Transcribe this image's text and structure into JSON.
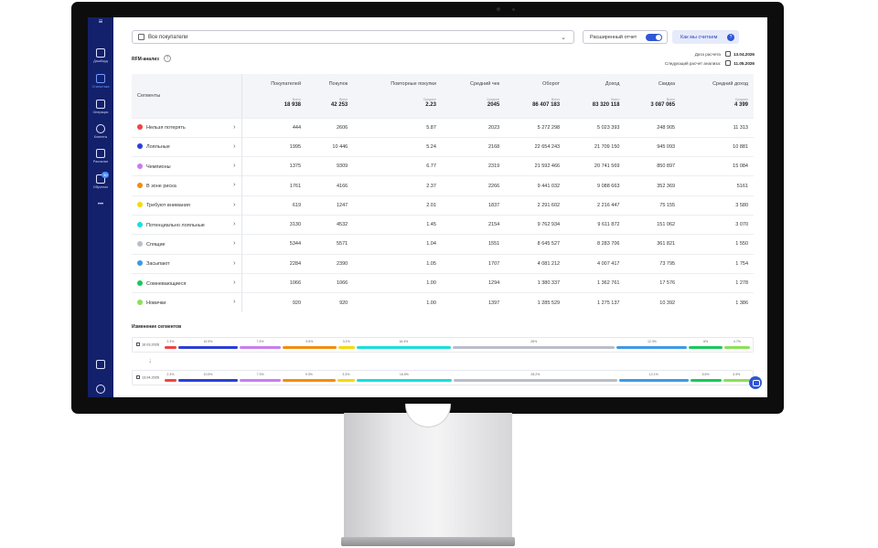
{
  "sidebar": {
    "items": [
      {
        "label": "Дашборд",
        "icon": "dashboard-icon"
      },
      {
        "label": "Статистика",
        "icon": "statistics-icon",
        "active": true
      },
      {
        "label": "Операции",
        "icon": "operations-icon"
      },
      {
        "label": "Клиенты",
        "icon": "clients-icon"
      },
      {
        "label": "Рассылки",
        "icon": "mailing-icon"
      },
      {
        "label": "Обучение",
        "icon": "learning-icon",
        "badge": "30"
      }
    ],
    "more": "•••"
  },
  "filter": {
    "value": "Все покупатели"
  },
  "extended_report": {
    "label": "Расширенный отчет",
    "on": true
  },
  "how_we_count": {
    "label": "Как мы считаем"
  },
  "rfm_title": "RFM-анализ",
  "dates": {
    "calc_label": "Дата расчета",
    "calc_value": "13.04.2026",
    "next_label": "Следующий расчет анализа:",
    "next_value": "11.05.2026"
  },
  "table": {
    "segment_header": "Сегменты",
    "columns": [
      {
        "label": "Покупателей",
        "tot_label": "Всего",
        "tot": "18 938"
      },
      {
        "label": "Покупок",
        "tot_label": "Всего",
        "tot": "42 253"
      },
      {
        "label": "Повторные покупки",
        "tot_label": "Среднее",
        "tot": "2.23"
      },
      {
        "label": "Средний чек",
        "tot_label": "Среднее",
        "tot": "2045"
      },
      {
        "label": "Оборот",
        "tot_label": "Всего",
        "tot": "86 407 183"
      },
      {
        "label": "Доход",
        "tot_label": "Всего",
        "tot": "83 320 118"
      },
      {
        "label": "Скидка",
        "tot_label": "Всего",
        "tot": "3 087 065"
      },
      {
        "label": "Средний доход",
        "tot_label": "Среднее",
        "tot": "4 399"
      }
    ],
    "rows": [
      {
        "name": "Нельзя потерять",
        "color": "#ef4444",
        "vals": [
          "444",
          "2606",
          "5.87",
          "2023",
          "5 272 298",
          "5 023 393",
          "248 905",
          "11 313"
        ]
      },
      {
        "name": "Лояльные",
        "color": "#2b3fd6",
        "vals": [
          "1995",
          "10 446",
          "5.24",
          "2168",
          "22 654 243",
          "21 709 150",
          "945 093",
          "10 881"
        ]
      },
      {
        "name": "Чемпионы",
        "color": "#c77df0",
        "vals": [
          "1375",
          "9309",
          "6.77",
          "2319",
          "21 592 466",
          "20 741 569",
          "850 897",
          "15 084"
        ]
      },
      {
        "name": "В зоне риска",
        "color": "#f28c0f",
        "vals": [
          "1761",
          "4166",
          "2.37",
          "2266",
          "9 441 032",
          "9 088 663",
          "352 369",
          "5161"
        ]
      },
      {
        "name": "Требуют внимания",
        "color": "#f5d90a",
        "vals": [
          "619",
          "1247",
          "2.01",
          "1837",
          "2 291 602",
          "2 216 447",
          "75 155",
          "3 580"
        ]
      },
      {
        "name": "Потенциально лояльные",
        "color": "#19dede",
        "vals": [
          "3130",
          "4532",
          "1.45",
          "2154",
          "9 762 934",
          "9 611 872",
          "151 062",
          "3 070"
        ]
      },
      {
        "name": "Спящие",
        "color": "#b9bec9",
        "vals": [
          "5344",
          "5571",
          "1.04",
          "1551",
          "8 645 527",
          "8 283 706",
          "361 821",
          "1 550"
        ]
      },
      {
        "name": "Засыпают",
        "color": "#3d9ae8",
        "vals": [
          "2284",
          "2390",
          "1.05",
          "1707",
          "4 081 212",
          "4 007 417",
          "73 795",
          "1 754"
        ]
      },
      {
        "name": "Сомневающиеся",
        "color": "#18c95a",
        "vals": [
          "1066",
          "1066",
          "1.00",
          "1294",
          "1 380 337",
          "1 362 761",
          "17 576",
          "1 278"
        ]
      },
      {
        "name": "Новички",
        "color": "#8be05a",
        "vals": [
          "920",
          "920",
          "1.00",
          "1397",
          "1 285 529",
          "1 275 137",
          "10 392",
          "1 386"
        ]
      }
    ]
  },
  "changes": {
    "title": "Изменение сегментов",
    "rows": [
      {
        "date": "16.03.2026",
        "pcts": [
          "2.3%",
          "10.5%",
          "7.3%",
          "9.5%",
          "3.1%",
          "16.4%",
          "28%",
          "12.3%",
          "6%",
          "4.7%"
        ],
        "shares": [
          2.3,
          10.5,
          7.3,
          9.5,
          3.1,
          16.4,
          28,
          12.3,
          6,
          4.7
        ]
      },
      {
        "date": "13.04.2026",
        "pcts": [
          "2.3%",
          "10.5%",
          "7.3%",
          "9.3%",
          "3.3%",
          "16.5%",
          "28.2%",
          "12.1%",
          "5.6%",
          "4.9%"
        ],
        "shares": [
          2.3,
          10.5,
          7.3,
          9.3,
          3.3,
          16.5,
          28.2,
          12.1,
          5.6,
          4.9
        ]
      }
    ]
  }
}
